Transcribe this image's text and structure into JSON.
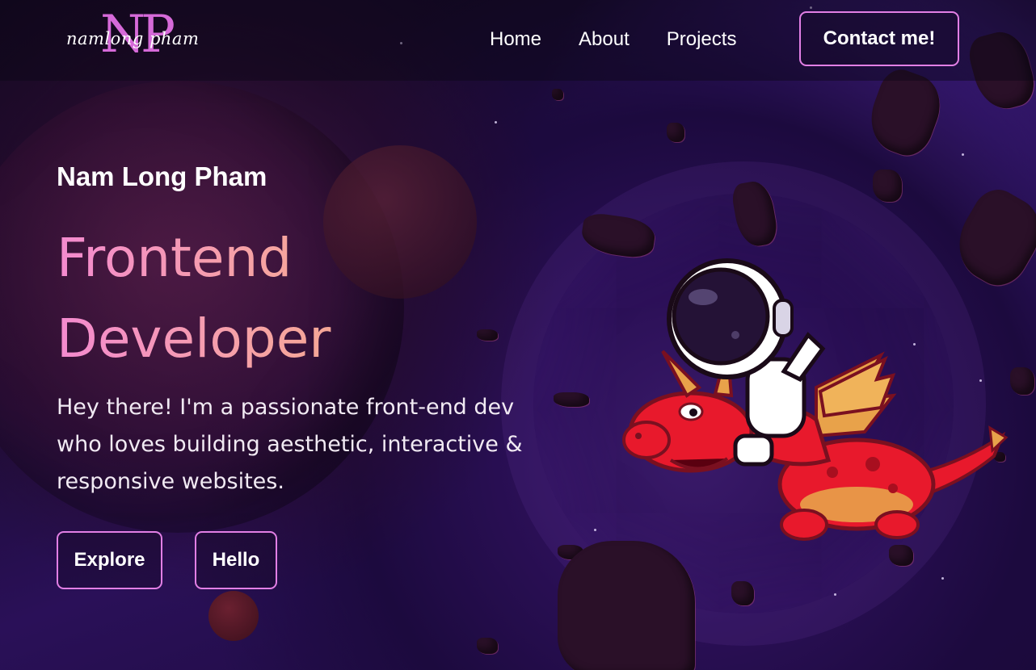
{
  "logo": {
    "letters": "NP",
    "script": "namlong pham"
  },
  "nav": {
    "links": [
      "Home",
      "About",
      "Projects"
    ],
    "contact_label": "Contact me!"
  },
  "hero": {
    "name": "Nam Long Pham",
    "title_line1": "Frontend",
    "title_line2": "Developer",
    "description": "Hey there! I'm a passionate front-end dev who loves building aesthetic, interactive & responsive websites.",
    "buttons": {
      "explore": "Explore",
      "hello": "Hello"
    }
  },
  "illustration": {
    "icon": "astronaut-riding-dragon-icon"
  },
  "colors": {
    "accent_border": "#e27fe5",
    "title_gradient_start": "#f48ad0",
    "title_gradient_end": "#f3a98a",
    "dragon_red": "#e8192c",
    "background_purple": "#2a1058"
  }
}
